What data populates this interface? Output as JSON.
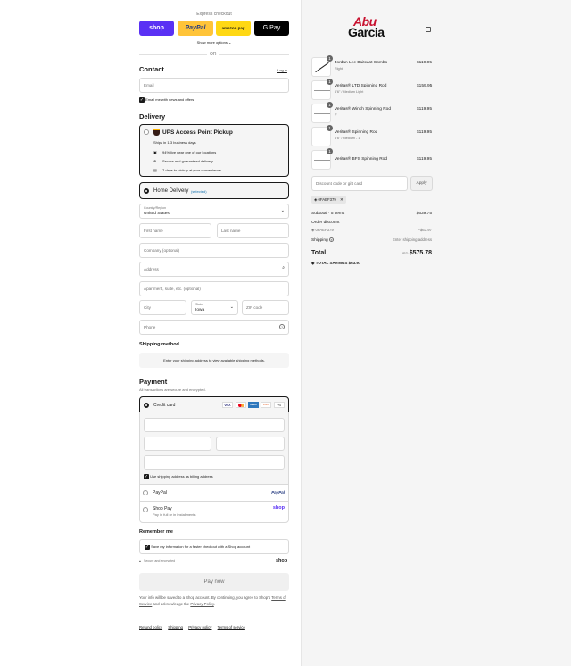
{
  "express": {
    "title": "Express checkout",
    "shop": "shop",
    "paypal": "PayPal",
    "amazon": "amazon pay",
    "gpay": "G Pay",
    "more": "Show more options ⌄",
    "or": "OR"
  },
  "contact": {
    "title": "Contact",
    "login": "Log in",
    "email_placeholder": "Email",
    "news": "Email me with news and offers"
  },
  "delivery": {
    "title": "Delivery",
    "ups_title": "UPS Access Point Pickup",
    "ups_sub": "Ships in 1-3 business days",
    "ups_points": [
      "94% live near one of our locations",
      "Secure and guaranteed delivery",
      "7 days to pickup at your convenience"
    ],
    "home": "Home Delivery",
    "selected": "(selected)",
    "country_label": "Country/Region",
    "country": "United States",
    "first": "First name",
    "last": "Last name",
    "company": "Company (optional)",
    "address": "Address",
    "apt": "Apartment, suite, etc. (optional)",
    "city": "City",
    "state_label": "State",
    "state": "Iowa",
    "zip": "ZIP code",
    "phone": "Phone"
  },
  "shipping": {
    "title": "Shipping method",
    "msg": "Enter your shipping address to view available shipping methods."
  },
  "payment": {
    "title": "Payment",
    "sub": "All transactions are secure and encrypted.",
    "credit": "Credit card",
    "cards": [
      "VISA",
      "MC",
      "AMEX",
      "DISC",
      "+4"
    ],
    "billing": "Use shipping address as billing address",
    "paypal": "PayPal",
    "paypal_logo": "PayPal",
    "shoppay": "Shop Pay",
    "shoppay_sub": "Pay in full or in installments",
    "shop_logo": "shop"
  },
  "remember": {
    "title": "Remember me",
    "save": "Save my information for a faster checkout with a Shop account",
    "secure": "Secure and encrypted",
    "shop": "shop"
  },
  "pay": {
    "button": "Pay now",
    "legal1": "Your info will be saved to a Shop account. By continuing, you agree to Shop's",
    "legal_tos": "Terms of Service",
    "legal2": "and acknowledge the",
    "legal_pp": "Privacy Policy",
    "legal_end": "."
  },
  "footer": [
    "Refund policy",
    "Shipping",
    "Privacy policy",
    "Terms of service"
  ],
  "brand": {
    "line1": "Abu",
    "line2": "Garcia"
  },
  "items": [
    {
      "qty": "1",
      "name": "Jordan Lee Baitcast Combo",
      "sub": "Right",
      "price": "$119.95"
    },
    {
      "qty": "1",
      "name": "Veritas® LTD Spinning Rod",
      "sub": "6'6\" / Medium Light",
      "price": "$159.95"
    },
    {
      "qty": "1",
      "name": "Veritas® Winch Spinning Rod",
      "sub": "7'",
      "price": "$119.95"
    },
    {
      "qty": "1",
      "name": "Veritas® Spinning Rod",
      "sub": "6'6\" / Medium - 1",
      "price": "$119.95"
    },
    {
      "qty": "1",
      "name": "Veritas® BFS Spinning Rod",
      "sub": "",
      "price": "$119.95"
    }
  ],
  "discount": {
    "placeholder": "Discount code or gift card",
    "apply": "Apply",
    "code": "0FAEF379"
  },
  "summary": {
    "subtotal_label": "Subtotal · 5 items",
    "subtotal": "$639.75",
    "order_discount": "Order discount",
    "code": "0FAEF379",
    "discount": "−$63.97",
    "shipping_label": "Shipping",
    "shipping": "Enter shipping address",
    "total_label": "Total",
    "currency": "USD",
    "total": "$575.78",
    "savings_label": "TOTAL SAVINGS",
    "savings": "$63.97"
  }
}
